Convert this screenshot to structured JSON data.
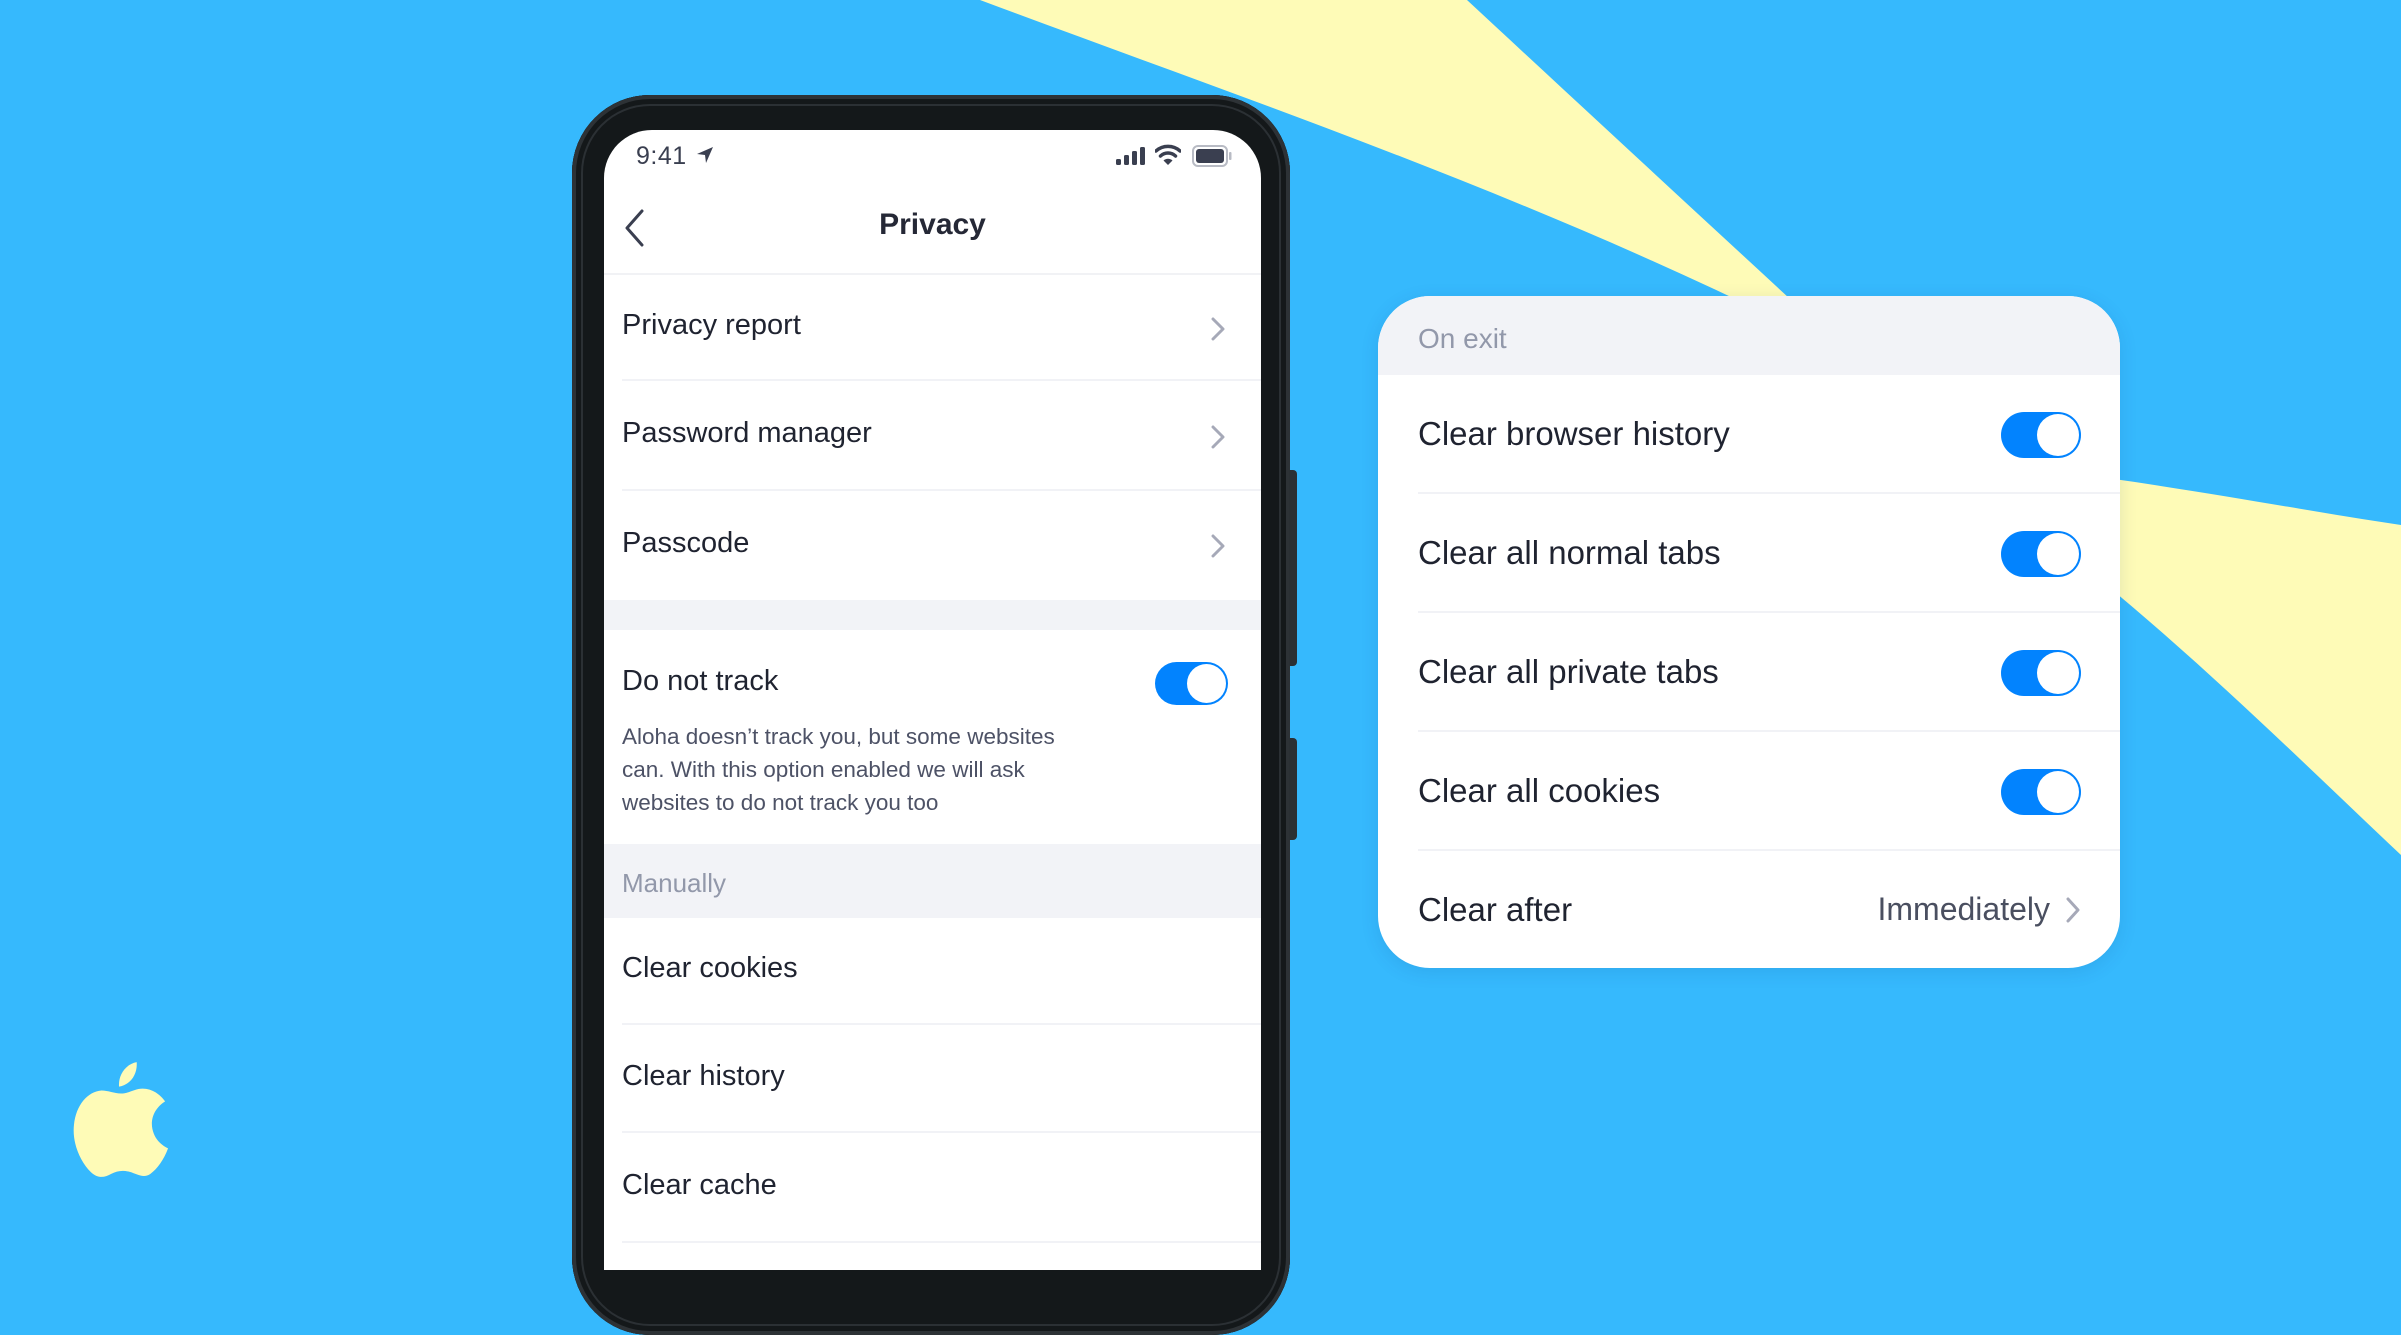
{
  "colors": {
    "background": "#36b9fd",
    "accent_shape": "#fefbb7",
    "toggle_on": "#0283fe",
    "phone_body": "#14181a",
    "section_bg": "#f2f3f7",
    "section_text": "#9298aa",
    "primary_text": "#1f2330"
  },
  "icons": {
    "brand": "apple-logo-icon",
    "status": [
      "location-arrow-icon",
      "cellular-signal-icon",
      "wifi-icon",
      "battery-icon"
    ],
    "nav_back": "chevron-left-icon",
    "row_disclosure": "chevron-right-icon"
  },
  "phone": {
    "status_bar": {
      "time": "9:41"
    },
    "nav": {
      "title": "Privacy",
      "back_label": "Back"
    },
    "menu_items": [
      {
        "label": "Privacy report",
        "has_chevron": true
      },
      {
        "label": "Password manager",
        "has_chevron": true
      },
      {
        "label": "Passcode",
        "has_chevron": true
      }
    ],
    "do_not_track": {
      "label": "Do not track",
      "enabled": true,
      "description": "Aloha doesn’t track you, but some websites can. With this option enabled we will ask websites to do not track you too"
    },
    "manual_section": {
      "header": "Manually",
      "items": [
        {
          "label": "Clear cookies"
        },
        {
          "label": "Clear history"
        },
        {
          "label": "Clear cache"
        }
      ]
    }
  },
  "card": {
    "header": "On exit",
    "toggles": [
      {
        "label": "Clear browser history",
        "enabled": true
      },
      {
        "label": "Clear all normal tabs",
        "enabled": true
      },
      {
        "label": "Clear all private tabs",
        "enabled": true
      },
      {
        "label": "Clear all cookies",
        "enabled": true
      }
    ],
    "clear_after": {
      "label": "Clear after",
      "value": "Immediately"
    }
  }
}
